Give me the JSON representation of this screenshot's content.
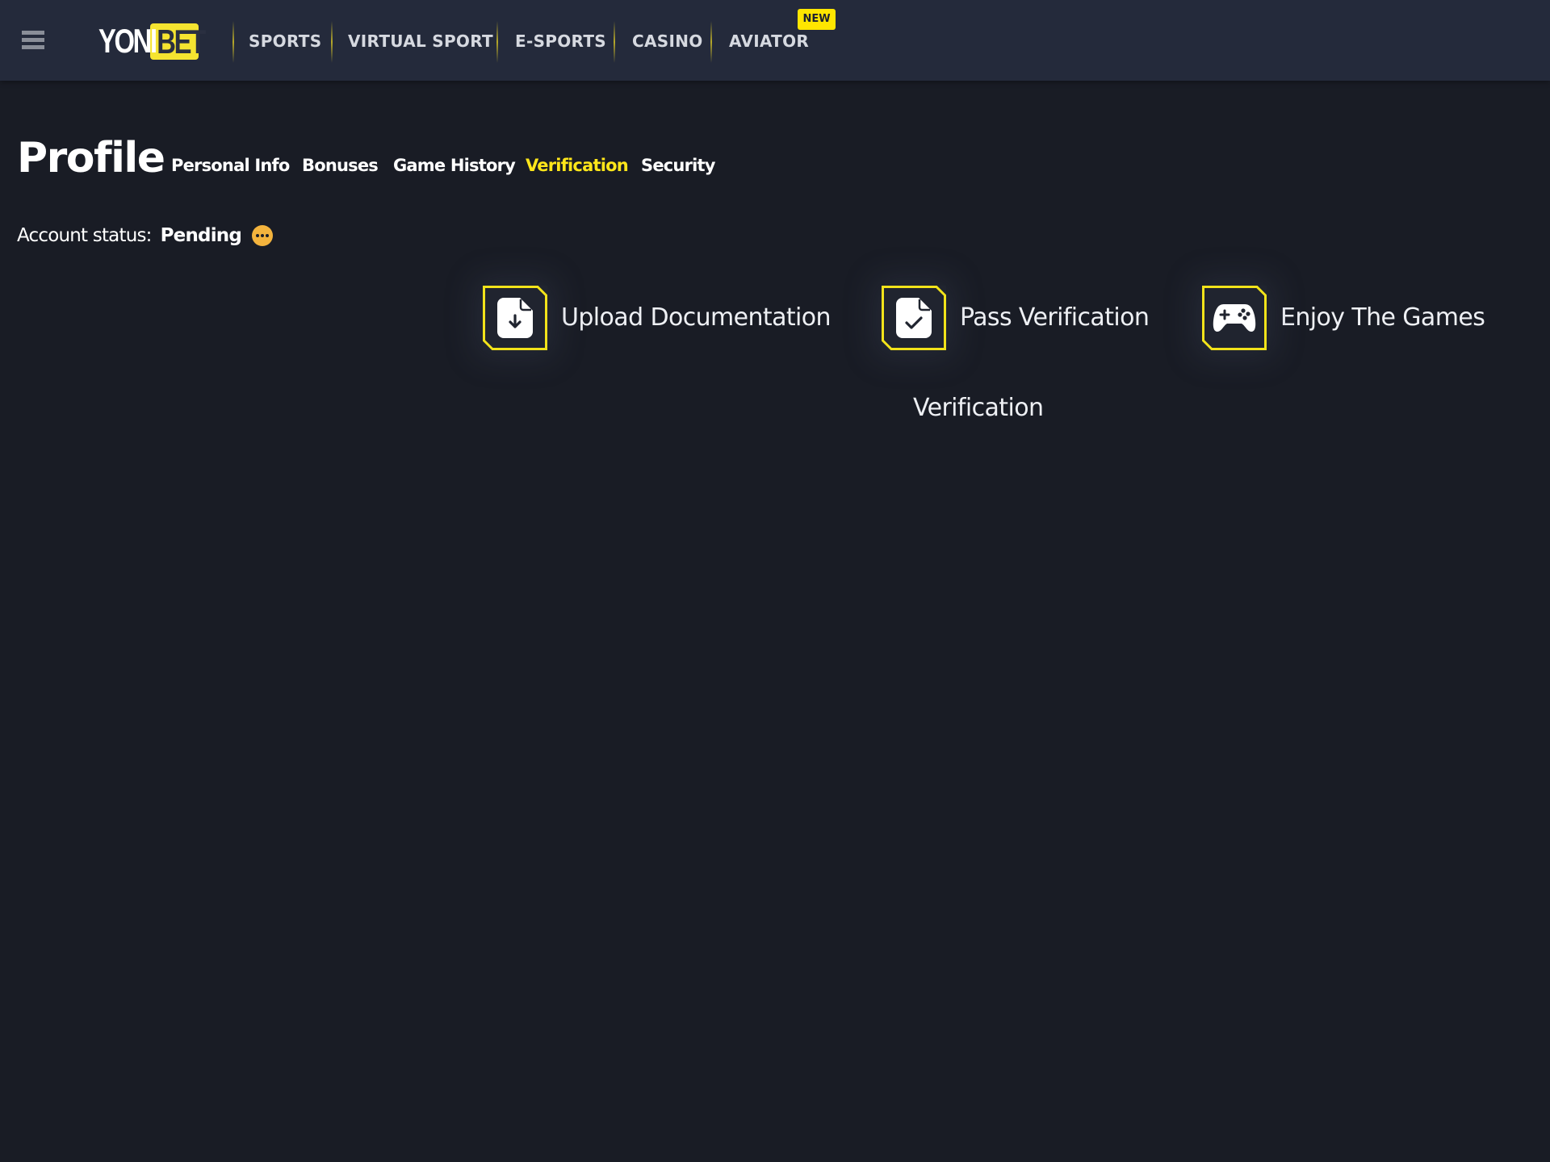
{
  "header": {
    "menu_icon": "hamburger-icon",
    "logo": {
      "part1": "YONI",
      "part2": "BET"
    },
    "nav": [
      {
        "label": "SPORTS"
      },
      {
        "label": "VIRTUAL SPORT"
      },
      {
        "label": "E-SPORTS"
      },
      {
        "label": "CASINO"
      },
      {
        "label": "AVIATOR",
        "badge": "NEW"
      }
    ]
  },
  "profile": {
    "title": "Profile",
    "tabs": [
      {
        "label": "Personal Info",
        "active": false
      },
      {
        "label": "Bonuses",
        "active": false
      },
      {
        "label": "Game History",
        "active": false
      },
      {
        "label": "Verification",
        "active": true
      },
      {
        "label": "Security",
        "active": false
      }
    ],
    "account_status": {
      "label": "Account status:",
      "value": "Pending",
      "icon": "more-dots-icon"
    }
  },
  "steps": [
    {
      "label": "Upload Documentation",
      "icon": "file-download-icon"
    },
    {
      "label": "Pass Verification",
      "icon": "file-check-icon"
    },
    {
      "label": "Enjoy The Games",
      "icon": "gamepad-icon"
    }
  ],
  "section_label": "Verification",
  "colors": {
    "accent": "#ffe61a",
    "header_bg": "#242a3b",
    "page_bg": "#191c25",
    "status_pending": "#f3b33d"
  }
}
